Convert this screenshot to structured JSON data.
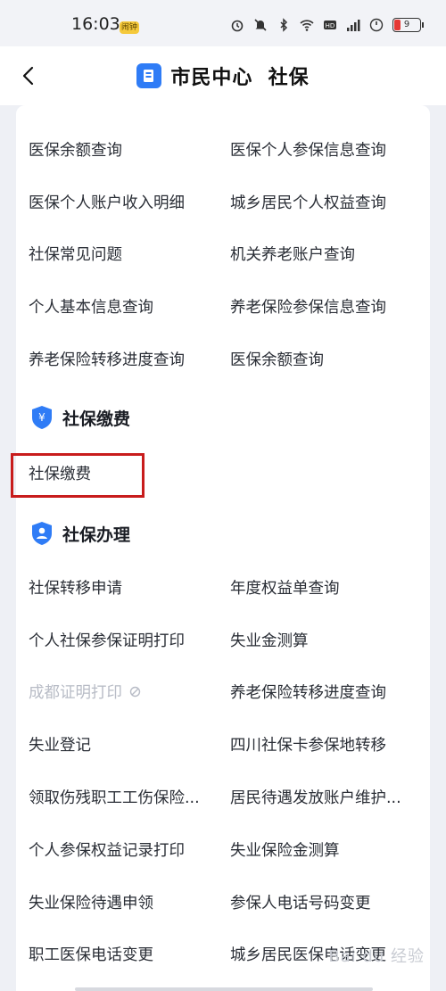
{
  "status_bar": {
    "time": "16:03",
    "chip": "闹钟",
    "battery": "9"
  },
  "nav": {
    "title": "市民中心  社保"
  },
  "query_items": [
    [
      "医保余额查询",
      "医保个人参保信息查询"
    ],
    [
      "医保个人账户收入明细",
      "城乡居民个人权益查询"
    ],
    [
      "社保常见问题",
      "机关养老账户查询"
    ],
    [
      "个人基本信息查询",
      "养老保险参保信息查询"
    ],
    [
      "养老保险转移进度查询",
      "医保余额查询"
    ]
  ],
  "section_payment": {
    "title": "社保缴费",
    "items": [
      "社保缴费"
    ]
  },
  "section_handling": {
    "title": "社保办理",
    "items": [
      [
        "社保转移申请",
        "年度权益单查询"
      ],
      [
        "个人社保参保证明打印",
        "失业金测算"
      ],
      [
        "成都证明打印",
        "养老保险转移进度查询"
      ],
      [
        "失业登记",
        "四川社保卡参保地转移"
      ],
      [
        "领取伤残职工工伤保险...",
        "居民待遇发放账户维护..."
      ],
      [
        "个人参保权益记录打印",
        "失业保险金测算"
      ],
      [
        "失业保险待遇申领",
        "参保人电话号码变更"
      ],
      [
        "职工医保电话变更",
        "城乡居民医保电话变更"
      ]
    ]
  },
  "watermark": "Bai du 经验",
  "colors": {
    "accent": "#2f7cf6",
    "highlight": "#c81c1c",
    "disabled": "#b8bcc6"
  }
}
